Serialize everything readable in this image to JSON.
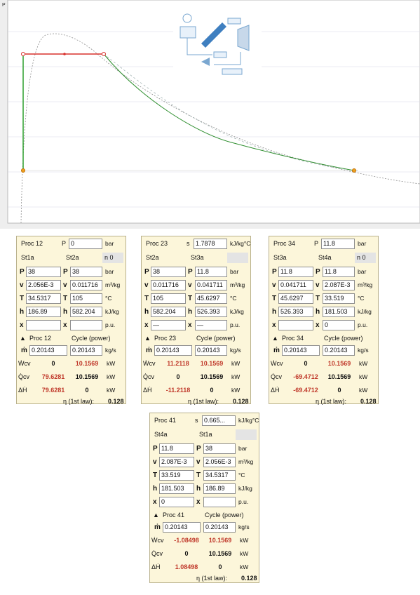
{
  "plot": {
    "axis_label": "P"
  },
  "panels": [
    {
      "proc": "Proc 12",
      "head_field_label": "P",
      "head_field_value": "0",
      "head_unit": "bar",
      "state_a": "St1a",
      "state_b": "St2a",
      "n_label": "n 0",
      "labels": [
        "P",
        "v",
        "T",
        "h",
        "x"
      ],
      "values_a": [
        "38",
        "2.056E-3",
        "34.5317",
        "186.89",
        ""
      ],
      "values_b": [
        "38",
        "0.011716",
        "105",
        "582.204",
        ""
      ],
      "units": [
        "bar",
        "m³/kg",
        "°C",
        "kJ/kg",
        "p.u."
      ],
      "proc_label": "Proc 12",
      "cycle_label": "Cycle (power)",
      "mdot_label": "ṁ",
      "mdot_a": "0.20143",
      "mdot_b": "0.20143",
      "mdot_unit": "kg/s",
      "rows": [
        {
          "label": "Ẇcv",
          "a": "0",
          "b": "10.1569",
          "unit": "kW"
        },
        {
          "label": "Q̇cv",
          "a": "79.6281",
          "b": "10.1569",
          "unit": "kW"
        },
        {
          "label": "ΔḢ",
          "a": "79.6281",
          "b": "0",
          "unit": "kW"
        }
      ],
      "eff_label": "η (1st law):",
      "eff_value": "0.128"
    },
    {
      "proc": "Proc 23",
      "head_field_label": "s",
      "head_field_value": "1.7878",
      "head_unit": "kJ/kg°C",
      "state_a": "St2a",
      "state_b": "St3a",
      "n_label": "",
      "labels": [
        "P",
        "v",
        "T",
        "h",
        "x"
      ],
      "values_a": [
        "38",
        "0.011716",
        "105",
        "582.204",
        "—"
      ],
      "values_b": [
        "11.8",
        "0.041711",
        "45.6297",
        "526.393",
        "—"
      ],
      "units": [
        "bar",
        "m³/kg",
        "°C",
        "kJ/kg",
        "p.u."
      ],
      "proc_label": "Proc 23",
      "cycle_label": "Cycle (power)",
      "mdot_label": "ṁ",
      "mdot_a": "0.20143",
      "mdot_b": "0.20143",
      "mdot_unit": "kg/s",
      "rows": [
        {
          "label": "Ẇcv",
          "a": "11.2118",
          "b": "10.1569",
          "unit": "kW"
        },
        {
          "label": "Q̇cv",
          "a": "0",
          "b": "10.1569",
          "unit": "kW"
        },
        {
          "label": "ΔḢ",
          "a": "-11.2118",
          "b": "0",
          "unit": "kW"
        }
      ],
      "eff_label": "η (1st law):",
      "eff_value": "0.128"
    },
    {
      "proc": "Proc 34",
      "head_field_label": "P",
      "head_field_value": "11.8",
      "head_unit": "bar",
      "state_a": "St3a",
      "state_b": "St4a",
      "n_label": "n 0",
      "labels": [
        "P",
        "v",
        "T",
        "h",
        "x"
      ],
      "values_a": [
        "11.8",
        "0.041711",
        "45.6297",
        "526.393",
        ""
      ],
      "values_b": [
        "11.8",
        "2.087E-3",
        "33.519",
        "181.503",
        "0"
      ],
      "units": [
        "bar",
        "m³/kg",
        "°C",
        "kJ/kg",
        "p.u."
      ],
      "proc_label": "Proc 34",
      "cycle_label": "Cycle (power)",
      "mdot_label": "ṁ",
      "mdot_a": "0.20143",
      "mdot_b": "0.20143",
      "mdot_unit": "kg/s",
      "rows": [
        {
          "label": "Ẇcv",
          "a": "0",
          "b": "10.1569",
          "unit": "kW"
        },
        {
          "label": "Q̇cv",
          "a": "-69.4712",
          "b": "10.1569",
          "unit": "kW"
        },
        {
          "label": "ΔḢ",
          "a": "-69.4712",
          "b": "0",
          "unit": "kW"
        }
      ],
      "eff_label": "η (1st law):",
      "eff_value": "0.128"
    },
    {
      "proc": "Proc 41",
      "head_field_label": "s",
      "head_field_value": "0.665...",
      "head_unit": "kJ/kg°C",
      "state_a": "St4a",
      "state_b": "St1a",
      "n_label": "",
      "labels": [
        "P",
        "v",
        "T",
        "h",
        "x"
      ],
      "values_a": [
        "11.8",
        "2.087E-3",
        "33.519",
        "181.503",
        "0"
      ],
      "values_b": [
        "38",
        "2.056E-3",
        "34.5317",
        "186.89",
        ""
      ],
      "units": [
        "bar",
        "m³/kg",
        "°C",
        "kJ/kg",
        "p.u."
      ],
      "proc_label": "Proc 41",
      "cycle_label": "Cycle (power)",
      "mdot_label": "ṁ",
      "mdot_a": "0.20143",
      "mdot_b": "0.20143",
      "mdot_unit": "kg/s",
      "rows": [
        {
          "label": "Ẇcv",
          "a": "-1.08498",
          "b": "10.1569",
          "unit": "kW"
        },
        {
          "label": "Q̇cv",
          "a": "0",
          "b": "10.1569",
          "unit": "kW"
        },
        {
          "label": "ΔḢ",
          "a": "1.08498",
          "b": "0",
          "unit": "kW"
        }
      ],
      "eff_label": "η (1st law):",
      "eff_value": "0.128"
    }
  ]
}
